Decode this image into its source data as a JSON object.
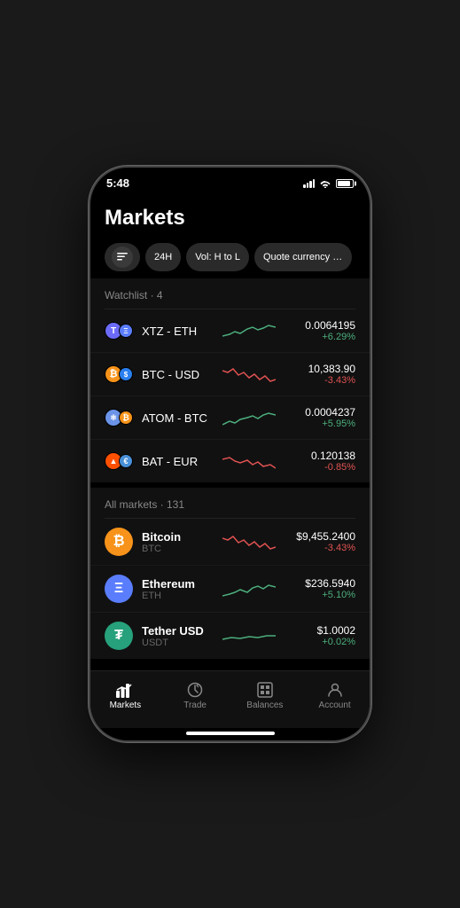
{
  "statusBar": {
    "time": "5:48"
  },
  "header": {
    "title": "Markets"
  },
  "filters": {
    "filterIcon": "≡",
    "period": "24H",
    "sort": "Vol: H to L",
    "quoteCurrency": "Quote currency · Al"
  },
  "watchlist": {
    "title": "Watchlist · 4",
    "items": [
      {
        "pair": "XTZ - ETH",
        "price": "0.0064195",
        "change": "+6.29%",
        "positive": true,
        "primaryColor": "#6C6BF7",
        "secondaryColor": "#5A7DFD",
        "primaryLabel": "T",
        "secondaryLabel": "Ξ"
      },
      {
        "pair": "BTC - USD",
        "price": "10,383.90",
        "change": "-3.43%",
        "positive": false,
        "primaryColor": "#F7931A",
        "secondaryColor": "#2A7FEF",
        "primaryLabel": "₿",
        "secondaryLabel": "$"
      },
      {
        "pair": "ATOM - BTC",
        "price": "0.0004237",
        "change": "+5.95%",
        "positive": true,
        "primaryColor": "#6B93E8",
        "secondaryColor": "#F7931A",
        "primaryLabel": "⚛",
        "secondaryLabel": "₿"
      },
      {
        "pair": "BAT - EUR",
        "price": "0.120138",
        "change": "-0.85%",
        "positive": false,
        "primaryColor": "#FF5000",
        "secondaryColor": "#4A90D9",
        "primaryLabel": "▲",
        "secondaryLabel": "€"
      }
    ]
  },
  "allMarkets": {
    "title": "All markets · 131",
    "items": [
      {
        "name": "Bitcoin",
        "symbol": "BTC",
        "price": "$9,455.2400",
        "change": "-3.43%",
        "positive": false,
        "bgColor": "#F7931A",
        "label": "₿"
      },
      {
        "name": "Ethereum",
        "symbol": "ETH",
        "price": "$236.5940",
        "change": "+5.10%",
        "positive": true,
        "bgColor": "#5A7DFD",
        "label": "Ξ"
      },
      {
        "name": "Tether USD",
        "symbol": "USDT",
        "price": "$1.0002",
        "change": "+0.02%",
        "positive": true,
        "bgColor": "#26A17B",
        "label": "₮"
      }
    ]
  },
  "bottomNav": {
    "items": [
      {
        "label": "Markets",
        "icon": "⌂",
        "active": true
      },
      {
        "label": "Trade",
        "icon": "↻",
        "active": false
      },
      {
        "label": "Balances",
        "icon": "⊞",
        "active": false
      },
      {
        "label": "Account",
        "icon": "⊙",
        "active": false
      }
    ]
  }
}
